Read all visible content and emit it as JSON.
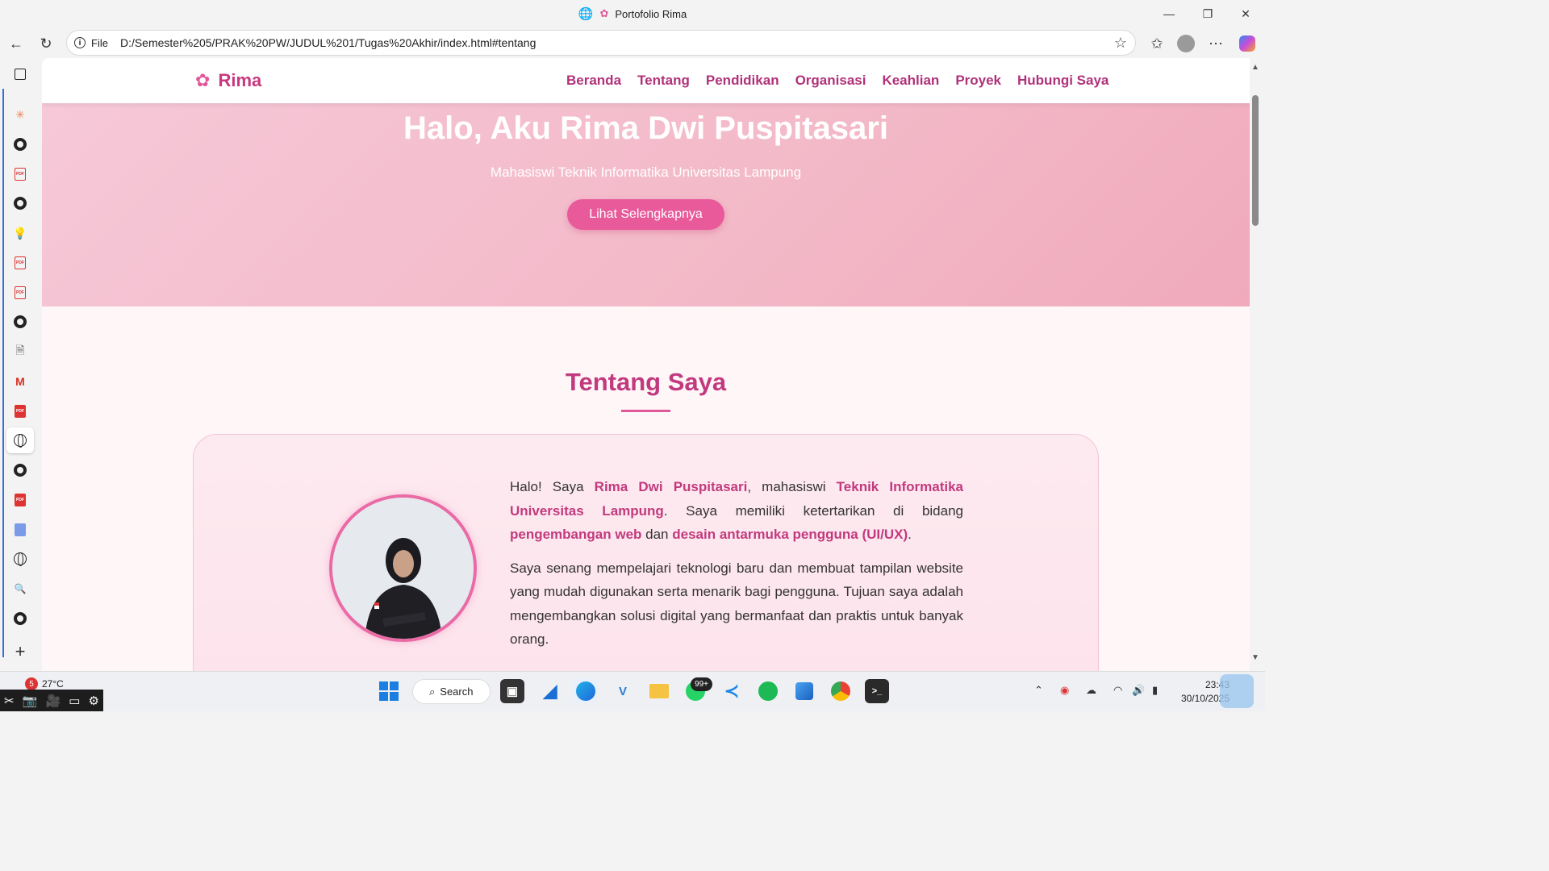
{
  "window": {
    "title": "Portofolio Rima",
    "controls": [
      "—",
      "❐",
      "✕"
    ]
  },
  "addressbar": {
    "scheme_label": "File",
    "url": "D:/Semester%205/PRAK%20PW/JUDUL%201/Tugas%20Akhir/index.html#tentang"
  },
  "site": {
    "brand": "Rima",
    "nav": [
      "Beranda",
      "Tentang",
      "Pendidikan",
      "Organisasi",
      "Keahlian",
      "Proyek",
      "Hubungi Saya"
    ],
    "hero": {
      "title": "Halo, Aku Rima Dwi Puspitasari",
      "subtitle": "Mahasiswi Teknik Informatika Universitas Lampung",
      "button": "Lihat Selengkapnya"
    },
    "about": {
      "title": "Tentang Saya",
      "p1": {
        "t1": "Halo! Saya ",
        "name": "Rima Dwi Puspitasari",
        "t2": ", mahasiswi ",
        "univ": "Teknik Informatika Universitas Lampung",
        "t3": ". Saya memiliki ketertarikan di bidang ",
        "web": "pengembangan web",
        "t4": " dan ",
        "uiux": "desain antarmuka pengguna (UI/UX)",
        "t5": "."
      },
      "p2": "Saya senang mempelajari teknologi baru dan membuat tampilan website yang mudah digunakan serta menarik bagi pengguna. Tujuan saya adalah mengembangkan solusi digital yang bermanfaat dan praktis untuk banyak orang."
    }
  },
  "taskbar": {
    "weather_temp": "27°C",
    "weather_badge": "5",
    "search_label": "Search",
    "whatsapp_badge": "99+",
    "time": "23:43",
    "date": "30/10/2025"
  },
  "colors": {
    "accent": "#c23a7e",
    "hero_bg": "#f3b9c8",
    "button": "#e85a9a"
  }
}
